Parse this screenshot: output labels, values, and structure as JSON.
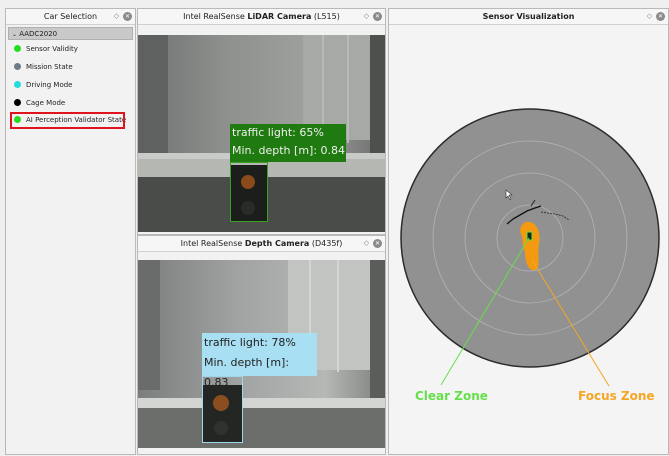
{
  "left_panel": {
    "title": "Car Selection",
    "root_label": "AADC2020",
    "items": [
      {
        "label": "Sensor Validity",
        "color": "#22dd22"
      },
      {
        "label": "Mission State",
        "color": "#6e7c88"
      },
      {
        "label": "Driving Mode",
        "color": "#22dddd"
      },
      {
        "label": "Cage Mode",
        "color": "#000000"
      },
      {
        "label": "AI Perception Validator State",
        "color": "#22dd22"
      }
    ]
  },
  "cam1": {
    "title_prefix": "Intel RealSense ",
    "title_bold": "LiDAR Camera",
    "title_suffix": " (L515)",
    "detection": {
      "line1": "traffic light: 65%",
      "line2": "Min. depth [m]: 0.84",
      "box_color": "#1f7a0f"
    }
  },
  "cam2": {
    "title_prefix": "Intel RealSense ",
    "title_bold": "Depth Camera",
    "title_suffix": " (D435f)",
    "detection": {
      "line1": "traffic light: 78%",
      "line2": "Min. depth [m]: 0.83",
      "box_color": "#a9dff3"
    }
  },
  "sensor": {
    "title": "Sensor Visualization",
    "clear_zone_label": "Clear Zone",
    "focus_zone_label": "Focus Zone",
    "clear_color": "#66e04a",
    "focus_color": "#f5a623"
  }
}
